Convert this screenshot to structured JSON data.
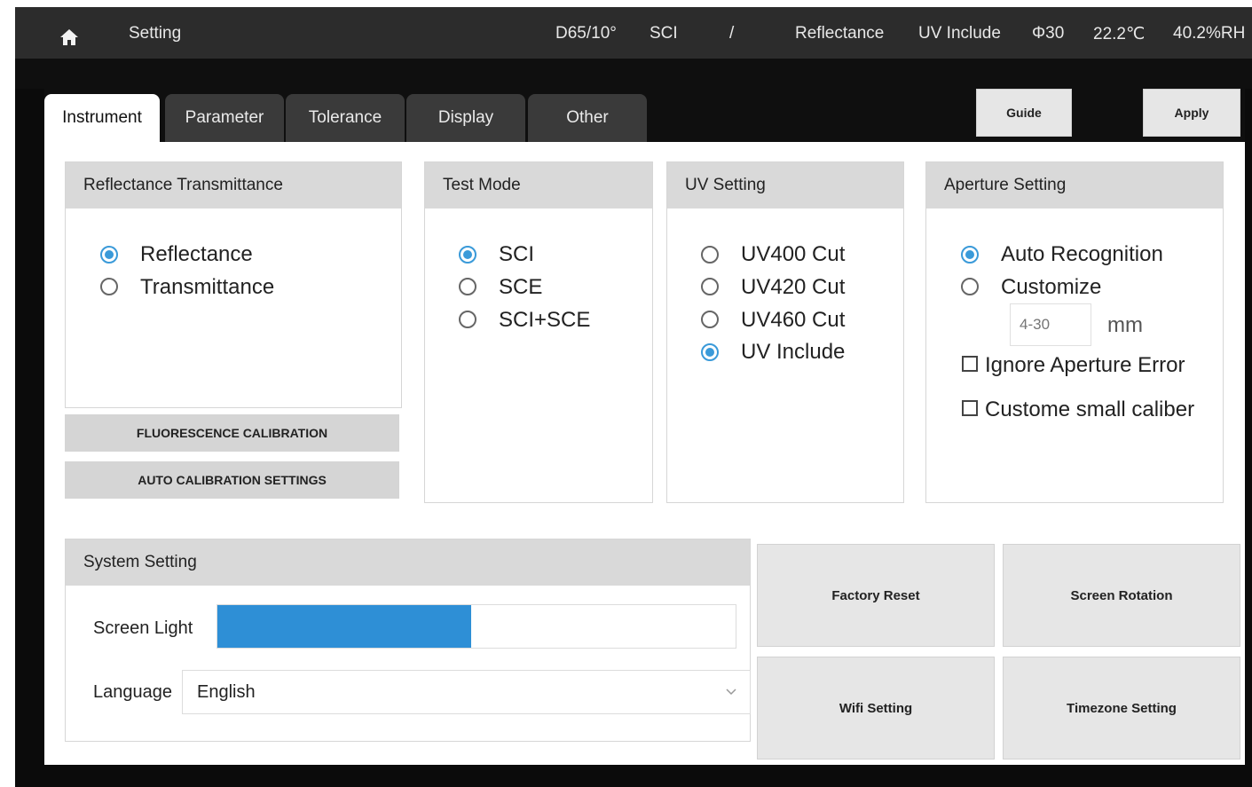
{
  "statusbar": {
    "title": "Setting",
    "illuminant": "D65/10°",
    "mode": "SCI",
    "separator": "/",
    "measure": "Reflectance",
    "uv": "UV Include",
    "aperture": "Φ30",
    "temperature": "22.2℃",
    "humidity": "40.2%RH"
  },
  "tabs": [
    "Instrument",
    "Parameter",
    "Tolerance",
    "Display",
    "Other"
  ],
  "actions": {
    "guide": "Guide",
    "apply": "Apply"
  },
  "reflectance_transmittance": {
    "title": "Reflectance Transmittance",
    "options": [
      "Reflectance",
      "Transmittance"
    ],
    "selected": "Reflectance"
  },
  "test_mode": {
    "title": "Test Mode",
    "options": [
      "SCI",
      "SCE",
      "SCI+SCE"
    ],
    "selected": "SCI"
  },
  "uv_setting": {
    "title": "UV Setting",
    "options": [
      "UV400 Cut",
      "UV420 Cut",
      "UV460 Cut",
      "UV Include"
    ],
    "selected": "UV Include"
  },
  "aperture_setting": {
    "title": "Aperture Setting",
    "options": [
      "Auto Recognition",
      "Customize"
    ],
    "selected": "Auto Recognition",
    "custom_placeholder": "4-30",
    "unit": "mm",
    "checkboxes": [
      "Ignore Aperture Error",
      "Custome small caliber"
    ]
  },
  "calibration": {
    "fluorescence": "FLUORESCENCE CALIBRATION",
    "auto": "AUTO CALIBRATION SETTINGS"
  },
  "system_setting": {
    "title": "System Setting",
    "screen_light_label": "Screen Light",
    "screen_light_level": 0.49,
    "language_label": "Language",
    "language_value": "English"
  },
  "system_buttons": {
    "factory_reset": "Factory Reset",
    "screen_rotation": "Screen Rotation",
    "wifi": "Wifi Setting",
    "timezone": "Timezone Setting"
  },
  "colors": {
    "accent": "#2e8fd6",
    "topbar": "#2c2c2c",
    "tab_inactive": "#3a3a3a",
    "header_gray": "#d9d9d9"
  },
  "icons": {
    "home": "home-icon",
    "dropdown": "chevron-down-icon"
  }
}
